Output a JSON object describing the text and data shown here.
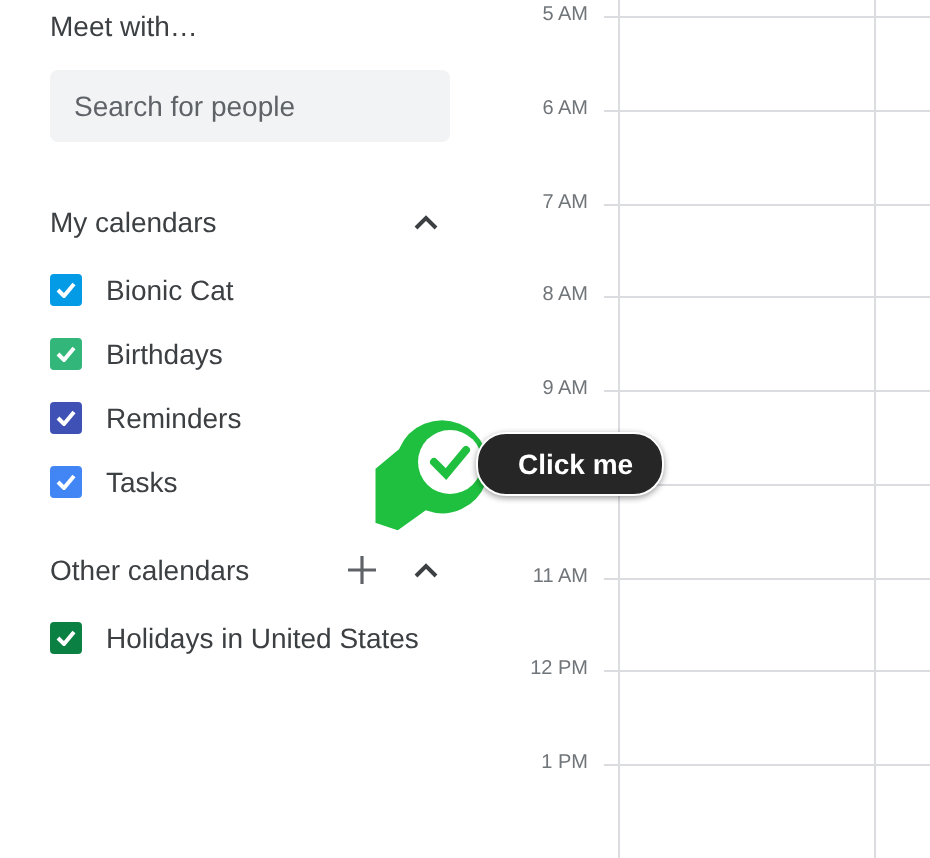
{
  "meet_with": {
    "title": "Meet with…",
    "search": {
      "placeholder": "Search for people"
    }
  },
  "sections": [
    {
      "title": "My calendars",
      "expanded": true,
      "can_add": false,
      "calendars": [
        {
          "name": "Bionic Cat",
          "checked": true,
          "color": "#039be5"
        },
        {
          "name": "Birthdays",
          "checked": true,
          "color": "#33b679"
        },
        {
          "name": "Reminders",
          "checked": true,
          "color": "#3f51b5"
        },
        {
          "name": "Tasks",
          "checked": true,
          "color": "#4285f4"
        }
      ]
    },
    {
      "title": "Other calendars",
      "expanded": true,
      "can_add": true,
      "calendars": [
        {
          "name": "Holidays in United States",
          "checked": true,
          "color": "#0b8043"
        }
      ]
    }
  ],
  "hours": [
    {
      "kind": "label",
      "label": "5 AM"
    },
    {
      "kind": "label",
      "label": "6 AM"
    },
    {
      "kind": "label",
      "label": "7 AM"
    },
    {
      "kind": "label",
      "label": "8 AM"
    },
    {
      "kind": "label",
      "label": "9 AM"
    },
    {
      "kind": "covered"
    },
    {
      "kind": "label",
      "label": "11 AM"
    },
    {
      "kind": "label",
      "label": "12 PM"
    },
    {
      "kind": "label",
      "label": "1 PM"
    }
  ],
  "tooltip": {
    "label": "Click me"
  }
}
